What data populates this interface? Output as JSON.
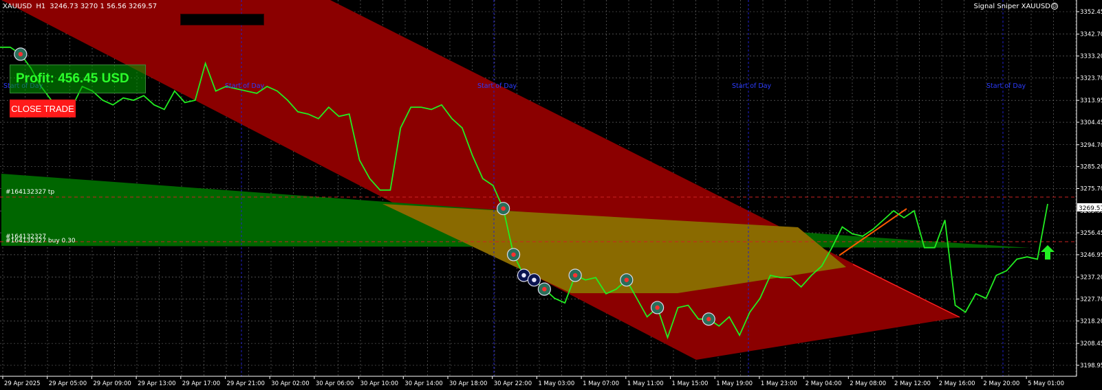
{
  "header": {
    "symbol": "XAUUSD",
    "timeframe": "H1",
    "ohlc": "3246.73 3270 1 56.56 3269.57",
    "indicator_name": "Signal Sniper XAUUSD",
    "indicator_icon": "smile-icon"
  },
  "profit_panel": {
    "text": "Profit: 456.45 USD",
    "close_label": "CLOSE TRADE"
  },
  "price_axis": {
    "ticks": [
      "3352.45",
      "3342.70",
      "3333.20",
      "3323.70",
      "3313.95",
      "3304.45",
      "3294.70",
      "3285.20",
      "3275.70",
      "3265.95",
      "3256.45",
      "3246.95",
      "3237.20",
      "3227.70",
      "3218.20",
      "3208.45",
      "3198.95"
    ],
    "current_price": "3269.57",
    "range": [
      3198.95,
      3352.45
    ]
  },
  "time_axis": {
    "labels": [
      "29 Apr 2025",
      "29 Apr 05:00",
      "29 Apr 09:00",
      "29 Apr 13:00",
      "29 Apr 17:00",
      "29 Apr 21:00",
      "30 Apr 02:00",
      "30 Apr 06:00",
      "30 Apr 10:00",
      "30 Apr 14:00",
      "30 Apr 18:00",
      "30 Apr 22:00",
      "1 May 03:00",
      "1 May 07:00",
      "1 May 11:00",
      "1 May 15:00",
      "1 May 19:00",
      "1 May 23:00",
      "2 May 04:00",
      "2 May 08:00",
      "2 May 12:00",
      "2 May 16:00",
      "2 May 20:00",
      "5 May 01:00"
    ]
  },
  "annotations": {
    "day_label": "Start of Day",
    "tp_label": "#164132327 tp",
    "order_label_a": "#164132327",
    "order_label_b": "#164132327 buy 0.30",
    "tp_price": 3274.2,
    "entry_price": 3253.6
  },
  "colors": {
    "background": "#000000",
    "grid": "#7a7a7a",
    "price_line": "#22ee22",
    "red_channel": "#8b0000",
    "green_channel": "#006600",
    "overlap": "#8a6a00",
    "day_separator": "#2020cc",
    "tp_line": "#cc2222",
    "profit_text": "#2bff2b",
    "close_button": "#ff1a1a"
  },
  "chart_data": {
    "type": "line",
    "series": [
      {
        "values": [
          3337,
          3337,
          3334,
          3328,
          3320,
          3314,
          3312,
          3311,
          3320,
          3318,
          3314,
          3312,
          3315,
          3314,
          3316,
          3312,
          3310,
          3318,
          3313,
          3314,
          3330,
          3318,
          3320,
          3319,
          3318,
          3317,
          3320,
          3318,
          3314,
          3309,
          3308,
          3306,
          3311,
          3307,
          3308,
          3288,
          3280,
          3275,
          3275,
          3302,
          3311,
          3311,
          3310,
          3312,
          3306,
          3302,
          3290,
          3280,
          3277,
          3267,
          3247,
          3238,
          3236,
          3232,
          3228,
          3226,
          3238,
          3236,
          3237,
          3230,
          3232,
          3236,
          3228,
          3220,
          3224,
          3211,
          3224,
          3225,
          3219,
          3219,
          3216,
          3220,
          3212,
          3222,
          3228,
          3238,
          3237,
          3237,
          3233,
          3238,
          3242,
          3250,
          3259,
          3256,
          3255,
          3258,
          3262,
          3266,
          3263,
          3266,
          3250,
          3250,
          3262,
          3225,
          3222,
          3230,
          3228,
          3238,
          3240,
          3245,
          3246,
          3245,
          3269
        ]
      }
    ]
  }
}
